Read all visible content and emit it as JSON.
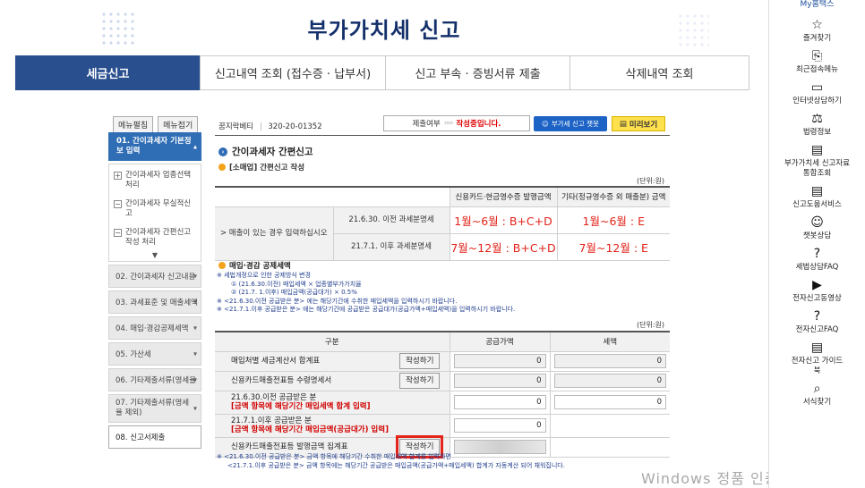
{
  "header": {
    "title": "부가가치세 신고"
  },
  "tabs": [
    {
      "label": "세금신고",
      "active": true
    },
    {
      "label": "신고내역 조회 (접수증 · 납부서)"
    },
    {
      "label": "신고 부속 · 증빙서류 제출"
    },
    {
      "label": "삭제내역 조회"
    }
  ],
  "left_menu": {
    "btn_expand": "메뉴펼침",
    "btn_collapse": "메뉴접기",
    "active_item": "01. 간이과세자 기본정보 입력",
    "sub_items": [
      {
        "label": "간이과세자 업종선택 처리",
        "box": "+"
      },
      {
        "label": "간이과세자 무실적신고",
        "box": "−"
      },
      {
        "label": "간이과세자 간편신고 작성 처리",
        "box": "−"
      }
    ],
    "items": [
      "02. 간이과세자 신고내용",
      "03. 과세표준 및 매출세액",
      "04. 매입·경감공제세액",
      "05. 가산세",
      "06. 기타제출서류(영세율",
      "07. 기타제출서류(영세율 제외)",
      "08. 신고서제출"
    ]
  },
  "top": {
    "business": "꿈지락베티",
    "separator": "|",
    "biz_no": "320-20-01352",
    "status_label": "제출여부",
    "status_arrows": "››››",
    "status_value": "작성중입니다.",
    "chatbot_label": "부가세 신고 챗봇",
    "preview_label": "미리보기"
  },
  "section": {
    "title": "간이과세자 간편신고",
    "subtitle": "[소매업] 간편신고 작성",
    "unit": "(단위:원)"
  },
  "table1": {
    "col_card": "신용카드·현금영수증 발행금액",
    "col_etc": "기타(정규영수증 외 매출분) 금액",
    "row_label": "> 매출이 있는 경우 입력하십시오",
    "rows": [
      {
        "period": "21.6.30. 이전 과세분명세",
        "card": "1월~6월 : B+C+D",
        "etc": "1월~6월 : E"
      },
      {
        "period": "21.7.1. 이후 과세분명세",
        "card": "7월~12월 : B+C+D",
        "etc": "7월~12월 : E"
      }
    ]
  },
  "deduction": {
    "title": "매입·경감 공제세액",
    "notes": [
      "세법개정으로 인한 공제방식 변경",
      "① (21.6.30.이전) 매입세액 × 업종별부가가치율",
      "② (21.7. 1.이후) 매입금액(공급대가) × 0.5%",
      "<21.6.30.이전 공급받은 분> 에는 해당기간에 수취한 매입세액을 입력하시기 바랍니다.",
      "<21.7.1.이후 공급받은 분> 에는 해당기간에 공급받은 공급대가(공급가액+매입세액)을 입력하시기 바랍니다."
    ],
    "unit": "(단위:원)"
  },
  "table2": {
    "headers": [
      "구분",
      "공급가액",
      "세액"
    ],
    "write_label": "작성하기",
    "rows": [
      {
        "label": "매입처별 세금계산서 합계표",
        "note": "",
        "has_button": true,
        "supply": "0",
        "tax": "0"
      },
      {
        "label": "신용카드매출전표등 수령명세서",
        "note": "",
        "has_button": true,
        "supply": "0",
        "tax": "0"
      },
      {
        "label": "21.6.30.이전 공급받은 분",
        "note": "[금액 항목에 해당기간 매입세액 합계 입력]",
        "has_button": false,
        "supply": "0",
        "tax": "0"
      },
      {
        "label": "21.7.1.이후 공급받은 분",
        "note": "[금액 항목에 해당기간 매입금액(공급대가) 입력]",
        "has_button": false,
        "supply": "0",
        "tax": ""
      },
      {
        "label": "신용카드매출전표등 발행금액 집계표",
        "note": "",
        "has_button": true,
        "supply": "",
        "tax": ""
      }
    ]
  },
  "footnotes": [
    "※ <21.6.30.이전 공급받은 분> 금액 항목에 해당기간 수취한 매입세액 합계를 입력하면",
    "<21.7.1.이후 공급받은 분> 금액 항목에는 해당기간 공급받은 매입금액(공급가액+매입세액) 합계가 자동계산 되어 채워집니다."
  ],
  "watermark": "Windows 정품 인증",
  "right_sidebar": {
    "top": "My홈택스",
    "items": [
      {
        "icon": "☆",
        "label": "즐겨찾기"
      },
      {
        "icon": "⎘",
        "label": "최근접속메뉴"
      },
      {
        "icon": "▭",
        "label": "인터넷상담하기"
      },
      {
        "icon": "⚖",
        "label": "법령정보"
      },
      {
        "icon": "▤",
        "label": "부가가치세 신고자료 통합조회"
      },
      {
        "icon": "▤",
        "label": "신고도움서비스"
      },
      {
        "icon": "☺",
        "label": "챗봇상담"
      },
      {
        "icon": "?",
        "label": "세법상담FAQ"
      },
      {
        "icon": "▶",
        "label": "전자신고동영상"
      },
      {
        "icon": "?",
        "label": "전자신고FAQ"
      },
      {
        "icon": "▤",
        "label": "전자신고 가이드북"
      },
      {
        "icon": "⌕",
        "label": "서식찾기"
      }
    ]
  }
}
